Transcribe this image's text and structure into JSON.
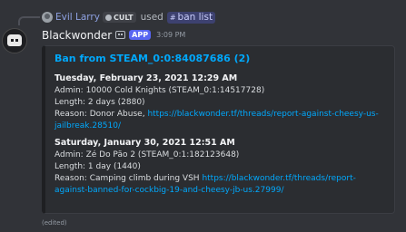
{
  "reply": {
    "user": "Evil Larry",
    "tag": "CULT",
    "used_text": "used",
    "command_icon": "slash-command-icon",
    "command_glyph": "#",
    "command": "ban list"
  },
  "message": {
    "author": "Blackwonder",
    "bot_icon": "bot-icon",
    "badge": "APP",
    "timestamp": "3:09 PM",
    "edited": "(edited)"
  },
  "embed": {
    "title": "Ban from STEAM_0:0:84087686 (2)",
    "entries": [
      {
        "date": "Tuesday, February 23, 2021 12:29 AM",
        "admin": "Admin: 10000 Cold Knights (STEAM_0:1:14517728)",
        "length": "Length: 2 days (2880)",
        "reason_prefix": "Reason: Donor Abuse,",
        "reason_link_1": "https://blackwonder.tf/threads/report-against-cheesy-us-",
        "reason_link_2": "jailbreak.28510/"
      },
      {
        "date": "Saturday, January 30, 2021 12:51 AM",
        "admin": "Admin: Zé Do Pão 2 (STEAM_0:1:182123648)",
        "length": "Length: 1 day (1440)",
        "reason_prefix": "Reason: Camping climb during VSH",
        "reason_link_1": "https://blackwonder.tf/threads/report-",
        "reason_link_2": "against-banned-for-cockbig-19-and-cheesy-jb-us.27999/"
      }
    ]
  },
  "colors": {
    "background": "#313338",
    "embed_bg": "#2b2d31",
    "link": "#00a8fc",
    "app_badge": "#5865f2"
  }
}
